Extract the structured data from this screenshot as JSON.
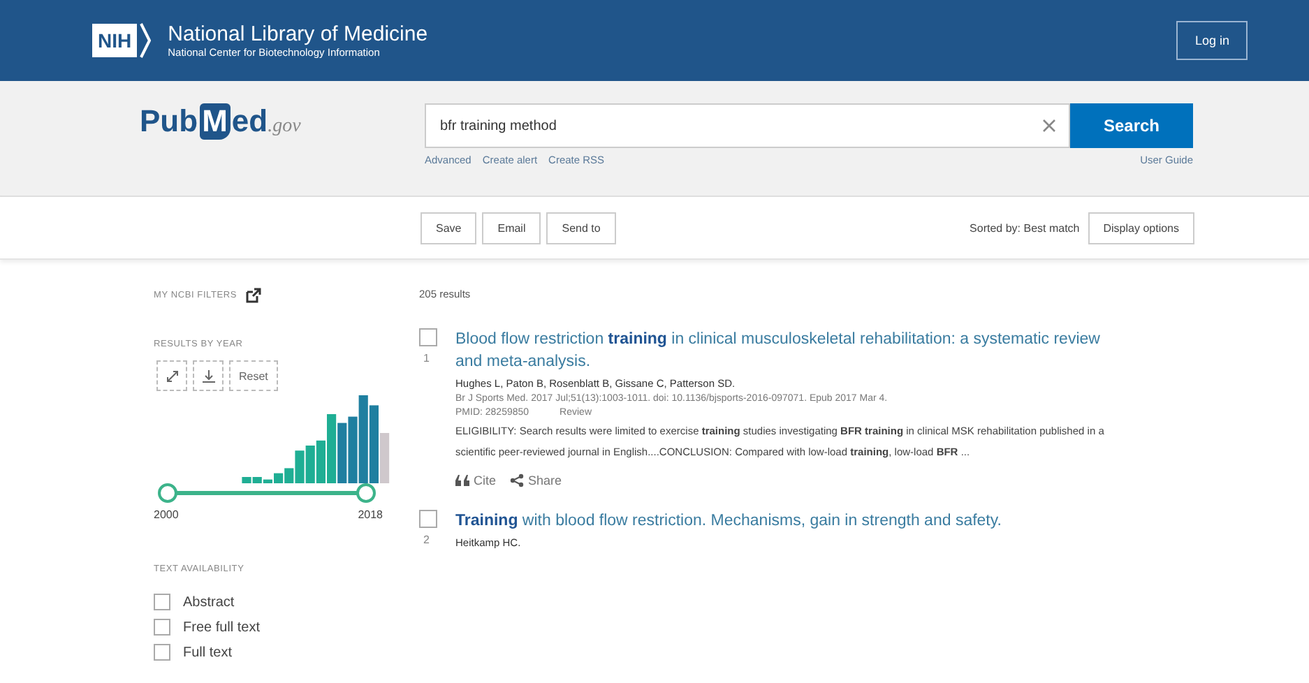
{
  "header": {
    "logo": "NIH",
    "title": "National Library of Medicine",
    "subtitle": "National Center for Biotechnology Information",
    "login": "Log in"
  },
  "search": {
    "logo": [
      "Pub",
      "M",
      "ed",
      ".gov"
    ],
    "value": "bfr training method",
    "button": "Search",
    "links": [
      "Advanced",
      "Create alert",
      "Create RSS"
    ],
    "guide": "User Guide"
  },
  "toolbar": {
    "actions": [
      "Save",
      "Email",
      "Send to"
    ],
    "sorted": "Sorted by: Best match",
    "display": "Display options"
  },
  "sidebar": {
    "filters_label": "MY NCBI FILTERS",
    "year_label": "RESULTS BY YEAR",
    "reset": "Reset",
    "year_start": "2000",
    "year_end": "2018",
    "availability_label": "TEXT AVAILABILITY",
    "availability": [
      {
        "label": "Abstract",
        "checked": false
      },
      {
        "label": "Free full text",
        "checked": false
      },
      {
        "label": "Full text",
        "checked": false
      }
    ]
  },
  "results_count": "205 results",
  "results": [
    {
      "number": "1",
      "checked": false,
      "title": "Blood flow restriction **training** in clinical musculoskeletal rehabilitation: a systematic review and meta-analysis.",
      "authors": "Hughes L, Paton B, Rosenblatt B, Gissane C, Patterson SD.",
      "citation": "Br J Sports Med. 2017 Jul;51(13):1003-1011. doi: 10.1136/bjsports-2016-097071. Epub 2017 Mar 4.",
      "pmid": "PMID: 28259850",
      "type": "Review",
      "snippet": "ELIGIBILITY: Search results were limited to exercise **training** studies investigating **BFR training** in clinical MSK rehabilitation published in a scientific peer-reviewed journal in English....CONCLUSION: Compared with low-load **training**, low-load **BFR** ...",
      "cite": "Cite",
      "share": "Share"
    },
    {
      "number": "2",
      "checked": false,
      "title": "**Training** with blood flow restriction. Mechanisms, gain in strength and safety.",
      "authors": "Heitkamp HC."
    }
  ]
}
